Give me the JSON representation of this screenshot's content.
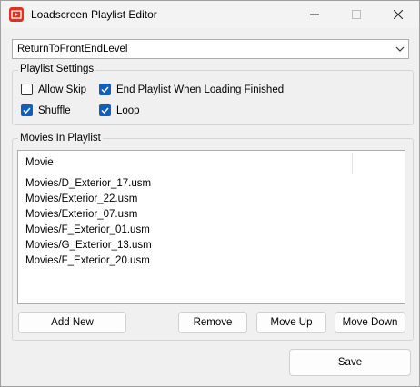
{
  "window": {
    "title": "Loadscreen Playlist Editor",
    "controls": [
      "minimize-icon",
      "maximize-icon",
      "close-icon"
    ]
  },
  "level_select": {
    "selected": "ReturnToFrontEndLevel"
  },
  "playlist_settings": {
    "title": "Playlist Settings",
    "allow_skip": {
      "label": "Allow Skip",
      "checked": false
    },
    "end_playlist": {
      "label": "End Playlist When Loading Finished",
      "checked": true
    },
    "shuffle": {
      "label": "Shuffle",
      "checked": true
    },
    "loop": {
      "label": "Loop",
      "checked": true
    }
  },
  "movies": {
    "title": "Movies In Playlist",
    "column_header": "Movie",
    "rows": [
      "Movies/D_Exterior_17.usm",
      "Movies/Exterior_22.usm",
      "Movies/Exterior_07.usm",
      "Movies/F_Exterior_01.usm",
      "Movies/G_Exterior_13.usm",
      "Movies/F_Exterior_20.usm"
    ],
    "buttons": {
      "add_new": "Add New",
      "remove": "Remove",
      "move_up": "Move Up",
      "move_down": "Move Down"
    }
  },
  "save_label": "Save",
  "colors": {
    "accent": "#0f5fbd",
    "app_icon": "#e0301e"
  }
}
